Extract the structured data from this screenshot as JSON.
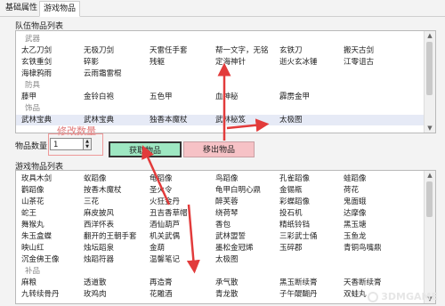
{
  "tabs": {
    "basic": "基础属性",
    "game_items": "游戏物品"
  },
  "team_list": {
    "title": "队伍物品列表",
    "rows": [
      {
        "type": "cat",
        "cells": [
          "武器"
        ]
      },
      {
        "cells": [
          "太乙刀剑",
          "无极刀剑",
          "天雷任手套",
          "帮一文字，无铭",
          "玄铁刀",
          "搬天古剑"
        ]
      },
      {
        "cells": [
          "玄铁重剑",
          "碎影",
          "残躯",
          "定海神针",
          "逝火玄冰锤",
          "江零诅古"
        ]
      },
      {
        "cells": [
          "海棣鸦雨",
          "云雨霜雷棍"
        ]
      },
      {
        "type": "cat",
        "cells": [
          "防具"
        ]
      },
      {
        "cells": [
          "藤甲",
          "金铃白袍",
          "五色甲",
          "血神秘",
          "霹雳金甲"
        ]
      },
      {
        "type": "cat",
        "cells": [
          "饰品"
        ]
      },
      {
        "cells": [
          "武林宝典",
          "武林宝典",
          "独香本魔杖",
          "武林秘笈",
          "太极图"
        ],
        "selected": true
      }
    ]
  },
  "quantity": {
    "label": "物品数量",
    "value": "1",
    "annotation": "修改数量"
  },
  "buttons": {
    "get": "获取物品",
    "remove": "移出物品"
  },
  "game_list": {
    "title": "游戏物品列表",
    "rows": [
      {
        "cells": [
          "玫具木剑",
          "蚁蹈像",
          "龟蹈像",
          "鸟蹈像",
          "孔雀蹈像",
          "蛙蹈像"
        ]
      },
      {
        "cells": [
          "鹳蹈像",
          "按香木魔杖",
          "圣火令",
          "龟甲白明心鼎",
          "金锡瓶",
          "荷花"
        ]
      },
      {
        "cells": [
          "山茶花",
          "三花",
          "火狂金丹",
          "醉芙蓉",
          "彩蝶蹈像",
          "鬼面蛾"
        ]
      },
      {
        "cells": [
          "蛇王",
          "麻皮披风",
          "丑吉香草帽",
          "绕荷琴",
          "投石机",
          "达摩像"
        ]
      },
      {
        "cells": [
          "舞猴丸",
          "西洋怀表",
          "酒仙葫芦",
          "香包",
          "精纸铃铛",
          "黑玉塘"
        ]
      },
      {
        "cells": [
          "朱玉盒蝶",
          "翻开的王朝手套",
          "机关武偶",
          "武林盟誓",
          "三彩武士俑",
          "玉鱼龙"
        ]
      },
      {
        "cells": [
          "映山红",
          "烛坛蹈泉",
          "金葫",
          "墨松金冠烯",
          "玉碎郡",
          "青铜鸟嘴鼎"
        ]
      },
      {
        "cells": [
          "沉金佛王像",
          "烛蹈符器",
          "温馨笔记",
          "太极图"
        ]
      },
      {
        "type": "cat",
        "cells": [
          "补品"
        ]
      },
      {
        "cells": [
          "麻粮",
          "透道散",
          "再造膏",
          "承气散",
          "黑玉断续膏",
          "天香断续膏"
        ]
      },
      {
        "cells": [
          "九转续骨丹",
          "玫鸡肉",
          "花雕酒",
          "青龙散",
          "子午醍醐丹",
          "双蛙丸"
        ]
      }
    ]
  },
  "watermark": {
    "text": "3DMGAME"
  },
  "colors": {
    "get_button": "#9ee7c2",
    "remove_button": "#f6c2c6",
    "annotation": "#e07a7a",
    "arrow": "#e23b3b"
  }
}
